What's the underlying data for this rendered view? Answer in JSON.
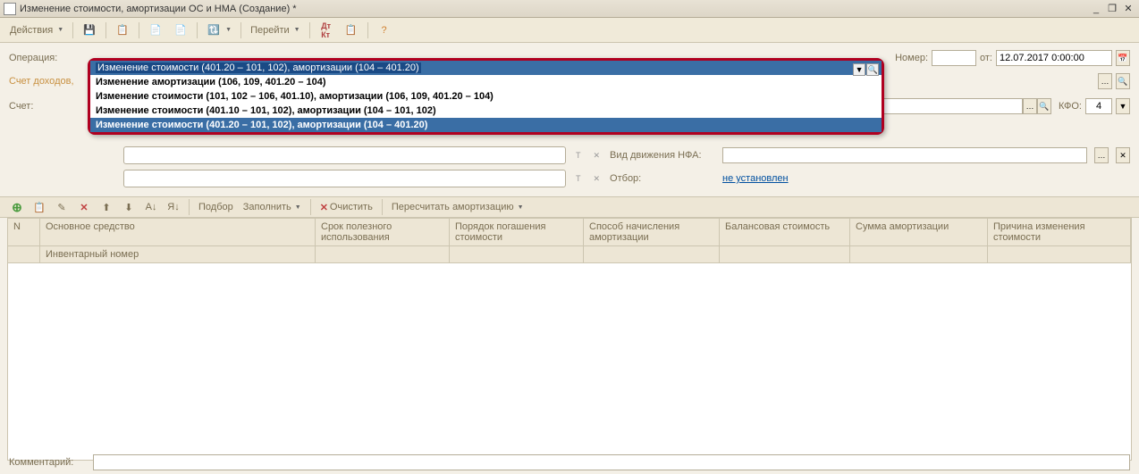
{
  "window": {
    "title": "Изменение стоимости, амортизации ОС и НМА (Создание) *"
  },
  "toolbar": {
    "actions": "Действия",
    "goto": "Перейти"
  },
  "form": {
    "operation_label": "Операция:",
    "income_label": "Счет доходов,",
    "account_label": "Счет:",
    "number_label": "Номер:",
    "from_label": "от:",
    "date_value": "12.07.2017 0:00:00",
    "kfo_label": "КФО:",
    "kfo_value": "4",
    "comment_label": "Комментарий:"
  },
  "operation": {
    "selected": "Изменение стоимости (401.20 – 101, 102), амортизации (104 – 401.20)",
    "options": [
      "Изменение амортизации (106, 109, 401.20 – 104)",
      "Изменение стоимости (101, 102 – 106, 401.10), амортизации (106, 109, 401.20 – 104)",
      "Изменение стоимости (401.10 – 101, 102), амортизации (104 – 101, 102)",
      "Изменение стоимости (401.20 – 101, 102), амортизации (104 – 401.20)"
    ]
  },
  "mid": {
    "nfa_label": "Вид движения НФА:",
    "filter_label": "Отбор:",
    "filter_value": "не установлен"
  },
  "grid_toolbar": {
    "select": "Подбор",
    "fill": "Заполнить",
    "clear": "Очистить",
    "recalc": "Пересчитать амортизацию"
  },
  "grid": {
    "columns": {
      "n": "N",
      "asset": "Основное средство",
      "inventory": "Инвентарный номер",
      "term": "Срок полезного использования",
      "order": "Порядок погашения стоимости",
      "method": "Способ начисления амортизации",
      "balance": "Балансовая стоимость",
      "amort_sum": "Сумма амортизации",
      "reason": "Причина изменения стоимости"
    }
  }
}
